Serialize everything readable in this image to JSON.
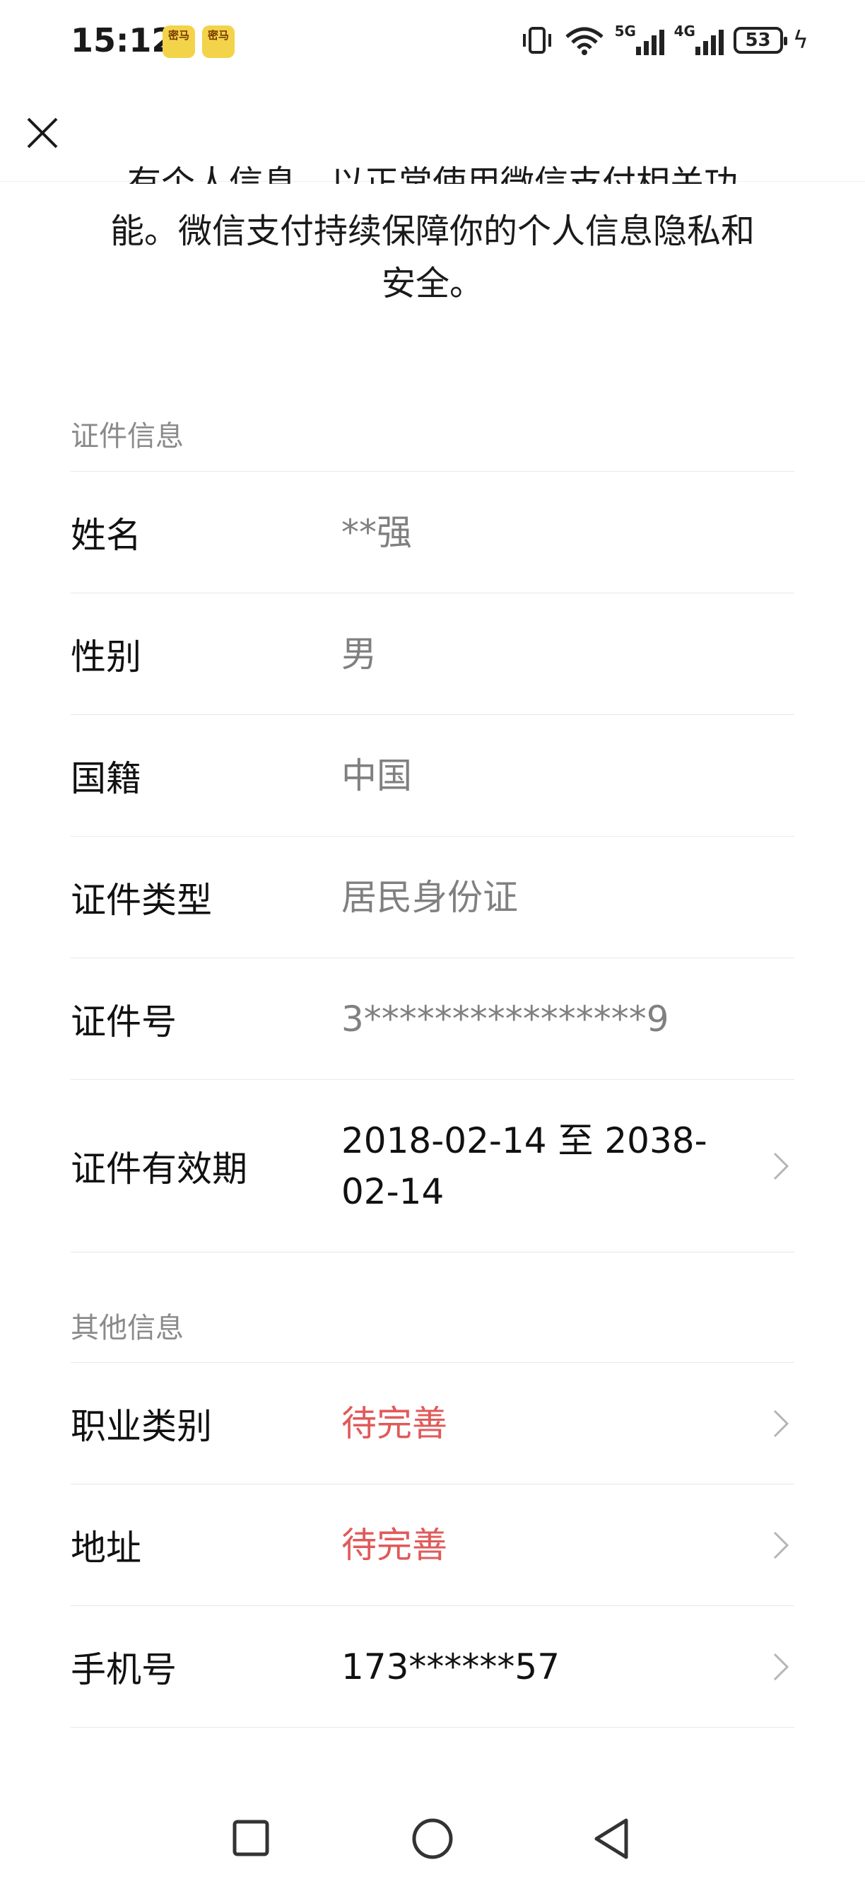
{
  "status_bar": {
    "time": "15:12",
    "notif_label": "密马",
    "signal1_label": "5G",
    "signal2_label": "4G",
    "battery": "53",
    "icons": [
      "vibrate-icon",
      "wifi-icon",
      "signal-5g-icon",
      "signal-4g-icon",
      "battery-icon",
      "charging-icon"
    ]
  },
  "nav": {
    "close_icon": "close-icon"
  },
  "intro": {
    "cut_line": "有个人信息，以正常使用微信支付相关功",
    "line2": "能。微信支付持续保障你的个人信息隐私和",
    "line3": "安全。"
  },
  "id_section": {
    "title": "证件信息",
    "rows": [
      {
        "label": "姓名",
        "value": "**强"
      },
      {
        "label": "性别",
        "value": "男"
      },
      {
        "label": "国籍",
        "value": "中国"
      },
      {
        "label": "证件类型",
        "value": "居民身份证"
      },
      {
        "label": "证件号",
        "value": "3****************9"
      },
      {
        "label": "证件有效期",
        "value": "2018-02-14 至 2038-02-14"
      }
    ]
  },
  "other_section": {
    "title": "其他信息",
    "rows": [
      {
        "label": "职业类别",
        "value": "待完善"
      },
      {
        "label": "地址",
        "value": "待完善"
      },
      {
        "label": "手机号",
        "value": "173******57"
      }
    ]
  },
  "colors": {
    "pending": "#e05a5a",
    "muted": "#808080",
    "divider": "#e8e8e8"
  }
}
